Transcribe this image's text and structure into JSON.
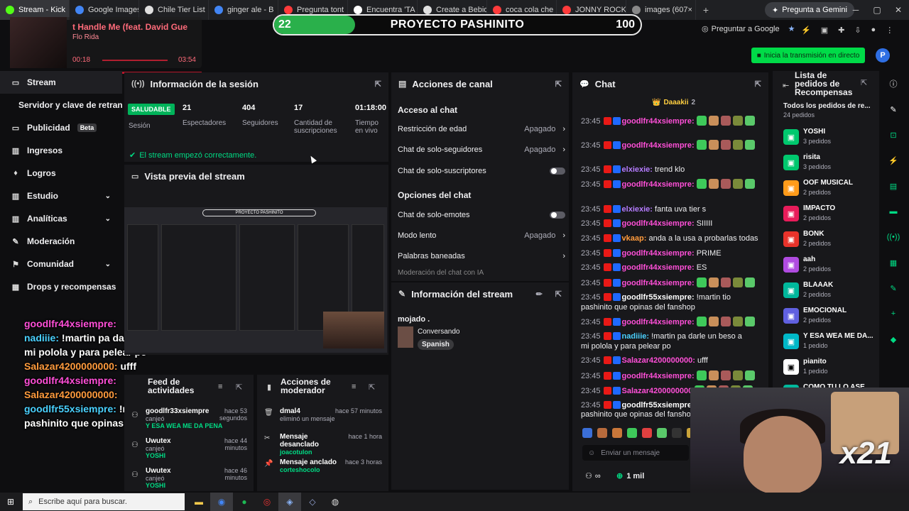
{
  "browser": {
    "tabs": [
      {
        "label": "Stream - Kick",
        "color": "#53fc18"
      },
      {
        "label": "Google Images",
        "color": "#4285f4"
      },
      {
        "label": "Chile Tier List",
        "color": "#e0e0e0"
      },
      {
        "label": "ginger ale - B",
        "color": "#4285f4"
      },
      {
        "label": "Pregunta tont",
        "color": "#ff3b3b"
      },
      {
        "label": "Encuentra 'TA",
        "color": "#ffffff"
      },
      {
        "label": "Create a Bebid",
        "color": "#e0e0e0"
      },
      {
        "label": "coca cola che",
        "color": "#ff3b3b"
      },
      {
        "label": "JONNY ROCK",
        "color": "#ff3b3b"
      },
      {
        "label": "images (607×",
        "color": "#888888"
      }
    ],
    "new_tab": "+",
    "gemini": "Pregunta a Gemini",
    "ask_google": "Preguntar a Google"
  },
  "goal": {
    "current": "22",
    "title": "PROYECTO PASHINITO",
    "total": "100",
    "progress": 0.22
  },
  "music": {
    "song": "t Handle Me (feat. David Gue",
    "artist": "Flo Rida",
    "elapsed": "00:18",
    "duration": "03:54"
  },
  "top": {
    "live_button": "Inicia la transmisión en directo",
    "avatar_letter": "P"
  },
  "sidebar": {
    "items": [
      {
        "label": "Stream",
        "icon": "▭"
      },
      {
        "label": "Servidor y clave de retransmisión",
        "icon": ""
      },
      {
        "label": "Publicidad",
        "icon": "▭",
        "badge": "Beta"
      },
      {
        "label": "Ingresos",
        "icon": "▥"
      },
      {
        "label": "Logros",
        "icon": "♦"
      },
      {
        "label": "Estudio",
        "icon": "▥"
      },
      {
        "label": "Analíticas",
        "icon": "▥"
      },
      {
        "label": "Moderación",
        "icon": "✎"
      },
      {
        "label": "Comunidad",
        "icon": "⚑"
      },
      {
        "label": "Drops y recompensas",
        "icon": "▦"
      }
    ]
  },
  "overlay_chat": [
    {
      "user": "goodlfr44xsiempre:",
      "msg": "",
      "color": "pink"
    },
    {
      "user": "nadiiie:",
      "msg": "!martin pa darle un beso a mi polola y para pelear po",
      "color": "blue"
    },
    {
      "user": "Salazar4200000000:",
      "msg": "ufff",
      "color": "orange"
    },
    {
      "user": "goodlfr44xsiempre:",
      "msg": "",
      "color": "pink"
    },
    {
      "user": "Salazar4200000000:",
      "msg": "",
      "color": "orange"
    },
    {
      "user": "goodlfr55xsiempre:",
      "msg": "!martin tio pashinito que opinas del fanshop",
      "color": "blue"
    }
  ],
  "session": {
    "title": "Información de la sesión",
    "status": "SALUDABLE",
    "status_label": "Sesión",
    "viewers": "21",
    "viewers_label": "Espectadores",
    "followers": "404",
    "followers_label": "Seguidores",
    "subs": "17",
    "subs_label": "Cantidad de suscripciones",
    "time": "01:18:00",
    "time_label": "Tiempo en vivo",
    "started": "El stream empezó correctamente."
  },
  "preview": {
    "title": "Vista previa del stream"
  },
  "channel": {
    "title": "Acciones de canal",
    "access": "Acceso al chat",
    "age": "Restricción de edad",
    "age_state": "Apagado",
    "followers_only": "Chat de solo-seguidores",
    "followers_state": "Apagado",
    "subs_only": "Chat de solo-suscriptores",
    "options": "Opciones del chat",
    "emotes": "Chat de solo-emotes",
    "slow": "Modo lento",
    "slow_state": "Apagado",
    "banned": "Palabras baneadas",
    "auto_mod": "Moderación del chat con IA"
  },
  "stream_info": {
    "title": "Información del stream",
    "stream_title": "mojado .",
    "category": "Conversando",
    "language": "Spanish"
  },
  "chat": {
    "title": "Chat",
    "pinned": "Daaakii",
    "pinned_count": "2",
    "lines": [
      {
        "ts": "23:45",
        "user": "goodlfr44xsiempre:",
        "msg": "",
        "ucolor": "#ff4fd8"
      },
      {
        "ts": "23:45",
        "user": "goodlfr44xsiempre:",
        "msg": "",
        "ucolor": "#ff4fd8"
      },
      {
        "ts": "23:45",
        "user": "elxiexie:",
        "msg": "trend klo",
        "ucolor": "#b57cff"
      },
      {
        "ts": "23:45",
        "user": "goodlfr44xsiempre:",
        "msg": "",
        "ucolor": "#ff4fd8"
      },
      {
        "ts": "23:45",
        "user": "elxiexie:",
        "msg": "fanta uva tier s",
        "ucolor": "#b57cff"
      },
      {
        "ts": "23:45",
        "user": "goodlfr44xsiempre:",
        "msg": "SIIIII",
        "ucolor": "#ff4fd8"
      },
      {
        "ts": "23:45",
        "user": "vkaap:",
        "msg": "anda a la usa a probarlas todas",
        "ucolor": "#ff9b3d"
      },
      {
        "ts": "23:45",
        "user": "goodlfr44xsiempre:",
        "msg": "PRIME",
        "ucolor": "#ff4fd8"
      },
      {
        "ts": "23:45",
        "user": "goodlfr44xsiempre:",
        "msg": "ES",
        "ucolor": "#ff4fd8"
      },
      {
        "ts": "23:45",
        "user": "goodlfr44xsiempre:",
        "msg": "",
        "ucolor": "#ff4fd8"
      },
      {
        "ts": "23:45",
        "user": "goodlfr55xsiempre:",
        "msg": "!martin tio",
        "ucolor": "#ffffff"
      },
      {
        "ts": "",
        "user": "",
        "msg": "pashinito que opinas del fanshop",
        "ucolor": "#ffffff"
      },
      {
        "ts": "23:45",
        "user": "goodlfr44xsiempre:",
        "msg": "",
        "ucolor": "#ff4fd8"
      },
      {
        "ts": "23:45",
        "user": "nadiiie:",
        "msg": "!martin pa darle un beso a",
        "ucolor": "#4ad1ff"
      },
      {
        "ts": "",
        "user": "",
        "msg": "mi polola y para pelear po",
        "ucolor": "#ffffff"
      },
      {
        "ts": "23:45",
        "user": "Salazar4200000000:",
        "msg": "ufff",
        "ucolor": "#ff4fd8"
      },
      {
        "ts": "23:45",
        "user": "goodlfr44xsiempre:",
        "msg": "",
        "ucolor": "#ff4fd8"
      },
      {
        "ts": "23:45",
        "user": "Salazar4200000000",
        "msg": "",
        "ucolor": "#ff4fd8"
      },
      {
        "ts": "23:45",
        "user": "goodlfr55xsiempre",
        "msg": "",
        "ucolor": "#ffffff"
      },
      {
        "ts": "",
        "user": "",
        "msg": "pashinito que opinas del fanshop",
        "ucolor": "#ffffff"
      }
    ],
    "input_placeholder": "Enviar un mensaje",
    "points": "1 mil",
    "infinity": "∞"
  },
  "rewards": {
    "title": "Lista de pedidos de Recompensas",
    "all_label": "Todos los pedidos de re...",
    "all_count": "24 pedidos",
    "items": [
      {
        "name": "YOSHI",
        "count": "3 pedidos",
        "color": "#00c86e"
      },
      {
        "name": "risita",
        "count": "3 pedidos",
        "color": "#00c86e"
      },
      {
        "name": "OOF MUSICAL",
        "count": "2 pedidos",
        "color": "#ff9b1a"
      },
      {
        "name": "IMPACTO",
        "count": "2 pedidos",
        "color": "#e81c5a"
      },
      {
        "name": "BONK",
        "count": "2 pedidos",
        "color": "#e8332b"
      },
      {
        "name": "aah",
        "count": "2 pedidos",
        "color": "#b04be0"
      },
      {
        "name": "BLAAAK",
        "count": "2 pedidos",
        "color": "#00b89c"
      },
      {
        "name": "EMOCIONAL",
        "count": "2 pedidos",
        "color": "#6060e0"
      },
      {
        "name": "Y ESA WEA ME DA...",
        "count": "1 pedido",
        "color": "#00b8c8"
      },
      {
        "name": "pianito",
        "count": "1 pedido",
        "color": "#ffffff"
      },
      {
        "name": "COMO TU LO ASE",
        "count": "",
        "color": "#00b89c"
      }
    ]
  },
  "feed": {
    "title": "Feed de actividades",
    "items": [
      {
        "name": "goodlfr33xsiempre",
        "action": "canjeó",
        "reward": "Y ESA WEA ME DA PENA",
        "time": "hace 53 segundos"
      },
      {
        "name": "Uwutex",
        "action": "canjeó",
        "reward": "YOSHI",
        "time": "hace 44 minutos"
      },
      {
        "name": "Uwutex",
        "action": "canjeó",
        "reward": "YOSHI",
        "time": "hace 46 minutos"
      }
    ]
  },
  "modactions": {
    "title": "Acciones de moderador",
    "items": [
      {
        "name": "dmal4",
        "detail": "eliminó un mensaje",
        "by": "",
        "time": "hace 57 minutos"
      },
      {
        "name": "Mensaje desanclado",
        "detail": "",
        "by": "joacotulon",
        "time": "hace 1 hora"
      },
      {
        "name": "Mensaje anclado",
        "detail": "",
        "by": "corteshocolo",
        "time": "hace 3 horas"
      },
      {
        "name": "Mensaje anclado",
        "detail": "",
        "by": "",
        "time": "hace 3 horas"
      }
    ]
  },
  "webcam": {
    "label": "x21"
  },
  "taskbar": {
    "search": "Escribe aquí para buscar."
  }
}
